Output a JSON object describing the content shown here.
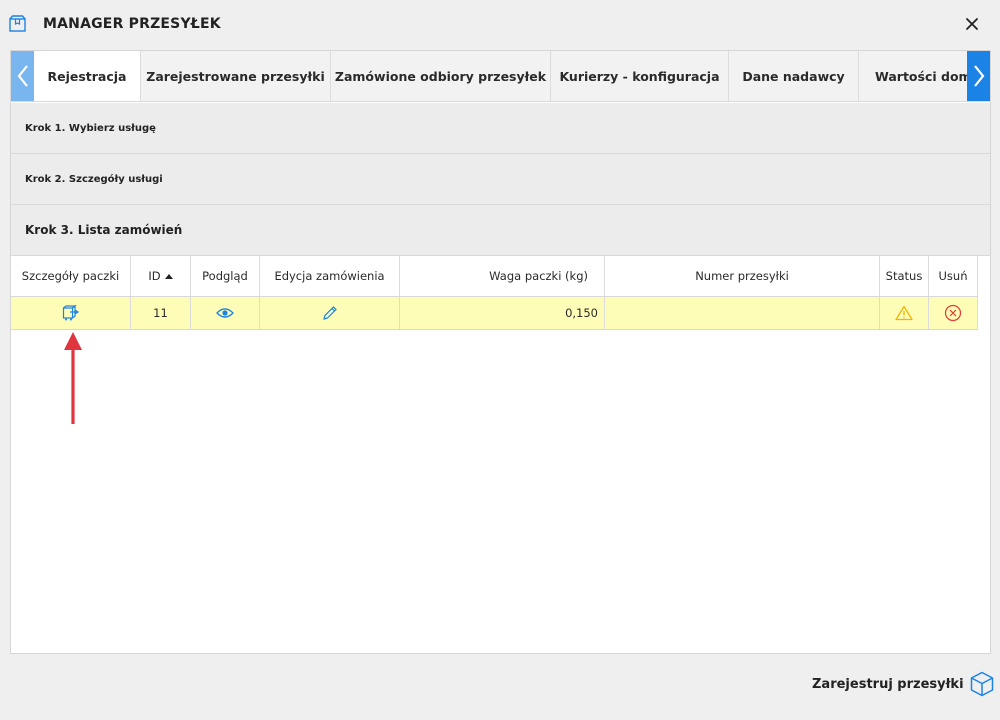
{
  "window": {
    "title": "MANAGER PRZESYŁEK",
    "icon": "package-box-icon",
    "close_icon": "close-icon"
  },
  "tabs": [
    {
      "label": "Rejestracja",
      "active": true
    },
    {
      "label": "Zarejestrowane przesyłki",
      "active": false
    },
    {
      "label": "Zamówione odbiory przesyłek",
      "active": false
    },
    {
      "label": "Kurierzy - konfiguracja",
      "active": false
    },
    {
      "label": "Dane nadawcy",
      "active": false
    },
    {
      "label": "Wartości domy",
      "active": false
    }
  ],
  "steps": {
    "step1": "Krok 1. Wybierz usługę",
    "step2": "Krok 2. Szczegóły usługi",
    "step3": "Krok 3. Lista zamówień"
  },
  "table": {
    "headers": {
      "details": "Szczegóły paczki",
      "id": "ID",
      "preview": "Podgląd",
      "edit": "Edycja zamówienia",
      "weight": "Waga paczki (kg)",
      "tracking": "Numer przesyłki",
      "status": "Status",
      "remove": "Usuń"
    },
    "sort": {
      "column": "id",
      "direction": "ascending"
    },
    "rows": [
      {
        "details_icon": "parcel-details-icon",
        "id": "11",
        "preview_icon": "eye-icon",
        "edit_icon": "pencil-icon",
        "weight": "0,150",
        "tracking": "",
        "status_icon": "warning-icon",
        "remove_icon": "remove-circle-icon",
        "highlight_color": "#fdfdb8"
      }
    ]
  },
  "footer": {
    "register_button": "Zarejestruj przesyłki",
    "register_icon": "cube-icon"
  },
  "colors": {
    "accent": "#1b83e6",
    "accent_light": "#79b6f0",
    "warning": "#f5b400",
    "danger": "#e53935",
    "annotation_arrow": "#e0353f"
  }
}
